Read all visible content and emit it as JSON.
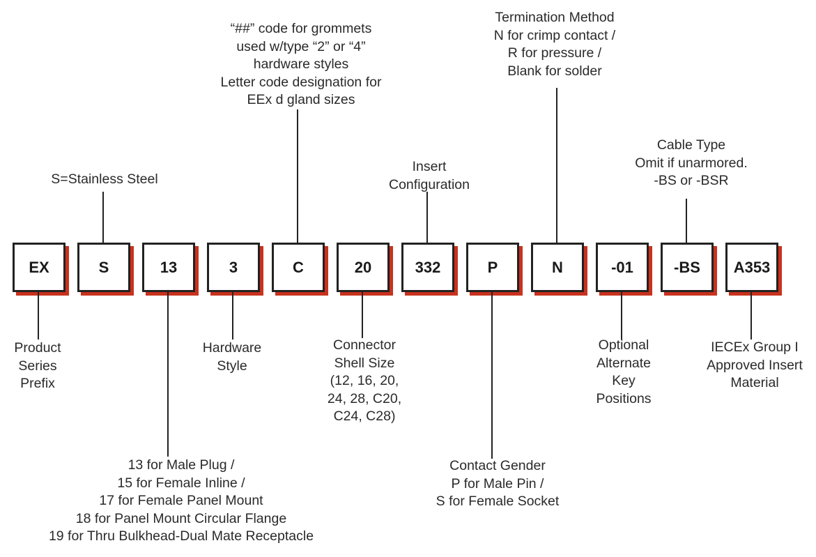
{
  "boxes": [
    "EX",
    "S",
    "13",
    "3",
    "C",
    "20",
    "332",
    "P",
    "N",
    "-01",
    "-BS",
    "A353"
  ],
  "labels": {
    "ex": [
      "Product",
      "Series",
      "Prefix"
    ],
    "s": [
      "S=Stainless Steel"
    ],
    "n13": [
      "13 for Male Plug /",
      "15 for Female Inline /",
      "17 for Female Panel Mount",
      "18 for Panel Mount Circular Flange",
      "19 for Thru Bulkhead-Dual Mate Receptacle"
    ],
    "n3": [
      "Hardware",
      "Style"
    ],
    "c": [
      "“##” code for grommets",
      "used w/type “2” or “4”",
      "hardware styles",
      "Letter code designation for",
      "EEx d gland sizes"
    ],
    "n20": [
      "Connector",
      "Shell Size",
      "(12, 16, 20,",
      "24, 28, C20,",
      "C24, C28)"
    ],
    "n332": [
      "Insert",
      "Configuration"
    ],
    "p": [
      "Contact Gender",
      "P for Male Pin /",
      "S for Female Socket"
    ],
    "n": [
      "Termination Method",
      "N for crimp contact /",
      "R for pressure /",
      "Blank for solder"
    ],
    "n01": [
      "Optional",
      "Alternate",
      "Key",
      "Positions"
    ],
    "bs": [
      "Cable Type",
      "Omit if unarmored.",
      "-BS or -BSR"
    ],
    "a353": [
      "IECEx Group I",
      "Approved Insert",
      "Material"
    ]
  },
  "colors": {
    "shadow": "#c8321e",
    "border": "#222222"
  }
}
